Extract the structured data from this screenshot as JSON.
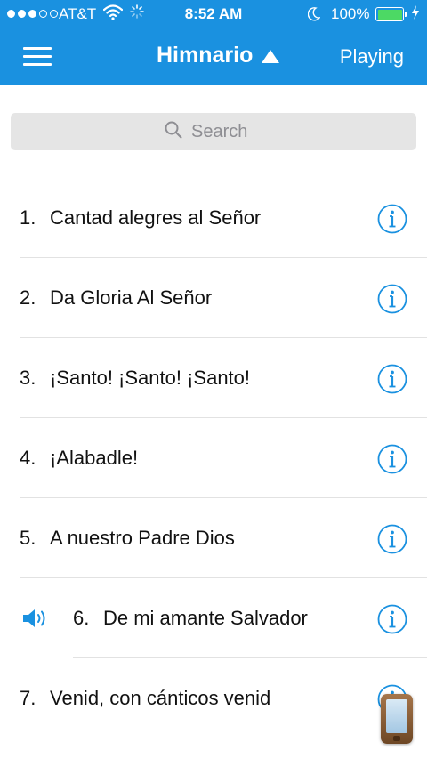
{
  "status_bar": {
    "carrier": "AT&T",
    "time": "8:52 AM",
    "battery": "100%"
  },
  "navbar": {
    "title": "Himnario",
    "right_label": "Playing",
    "menu_icon": "hamburger-menu-icon",
    "title_icon": "triangle-up-icon"
  },
  "search": {
    "placeholder": "Search",
    "value": ""
  },
  "hymns": [
    {
      "number": "1.",
      "title": "Cantad alegres al Señor"
    },
    {
      "number": "2.",
      "title": "Da Gloria Al Señor"
    },
    {
      "number": "3.",
      "title": "¡Santo! ¡Santo! ¡Santo!"
    },
    {
      "number": "4.",
      "title": "¡Alabadle!"
    },
    {
      "number": "5.",
      "title": "A nuestro Padre Dios"
    },
    {
      "number": "6.",
      "title": "De mi amante Salvador",
      "playing": true
    },
    {
      "number": "7.",
      "title": "Venid, con cánticos venid"
    }
  ],
  "colors": {
    "accent": "#1a91e0",
    "battery": "#4cd964",
    "search_bg": "#e5e5e5",
    "info": "#1a91e0"
  }
}
